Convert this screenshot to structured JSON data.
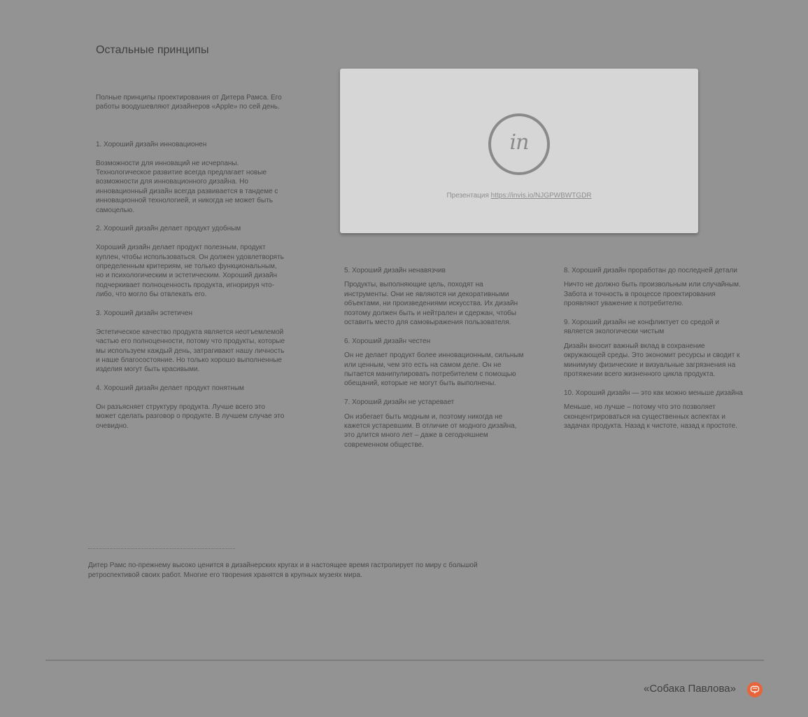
{
  "section_title": "Остальные принципы",
  "intro": "Полные  принципы проектирования от Дитера Рамса. Его работы воодушевляют дизайнеров «Apple» по сей день.",
  "principles": [
    {
      "title": "1. Хороший дизайн инновационен",
      "text": "Возможности для инноваций не исчерпаны. Технологическое развитие всегда предлагает новые возможности для инновационного дизайна. Но инновационный дизайн всегда развивается в тандеме с инновационной технологией, и никогда не может быть самоцелью."
    },
    {
      "title": "2. Хороший дизайн делает продукт удобным",
      "text": "Хороший дизайн делает продукт полезным, продукт куплен, чтобы использоваться. Он должен удовлетворять определенным критериям, не только функциональным, но и психологическим и эстетическим. Хороший дизайн подчеркивает полноценность продукта, игнорируя что-либо, что могло бы отвлекать его."
    },
    {
      "title": "3. Хороший дизайн эстетичен",
      "text": "Эстетическое качество продукта является неотъемлемой частью его полноценности, потому что продукты, которые мы используем каждый день, затрагивают нашу личность и наше благосостояние. Но только хорошо выполненные изделия могут быть красивыми."
    },
    {
      "title": "4. Хороший дизайн делает продукт понятным",
      "text": "Он разъясняет структуру продукта. Лучше всего это может сделать разговор о продукте. В лучшем случае это очевидно."
    },
    {
      "title": "5. Хороший дизайн ненавязчив",
      "text": "Продукты, выполняющие цель, походят на инструменты. Они не являются ни декоративными объектами, ни произведениями искусства. Их дизайн поэтому должен быть и нейтрален и сдержан, чтобы оставить место для самовыражения пользователя."
    },
    {
      "title": "6. Хороший дизайн честен",
      "text": "Он не делает продукт более инновационным, сильным или ценным, чем это есть на самом деле. Он не пытается манипулировать потребителем с помощью обещаний, которые не могут быть выполнены."
    },
    {
      "title": "7. Хороший дизайн не устаревает",
      "text": "Он избегает быть модным и, поэтому никогда не кажется устаревшим. В отличие от модного дизайна, это длится много лет – даже в сегодняшнем современном обществе."
    },
    {
      "title": "8. Хороший дизайн проработан до последней детали",
      "text": "Ничто не должно быть произвольным или случайным. Забота и точность в процессе проектирования проявляют уважение к потребителю."
    },
    {
      "title": "9. Хороший дизайн не конфликтует со средой и является экологически чистым",
      "text": "Дизайн вносит важный вклад в сохранение окружающей среды. Это экономит ресурсы и сводит к минимуму физические и визуальные загрязнения на протяжении всего жизненного цикла продукта."
    },
    {
      "title": "10. Хороший дизайн — это как можно меньше дизайна",
      "text": "Меньше, но лучше – потому что это позволяет сконцентрироваться на существенных аспектах и задачах продукта. Назад к чистоте, назад к простоте."
    }
  ],
  "prototype": {
    "logo_text": "in",
    "caption_prefix": "Презентация ",
    "link_text": "https://invis.io/NJGPWBWTGDR"
  },
  "footnote": "Дитер Рамс по-прежнему высоко ценится в дизайнерских кругах и в настоящее время гастролирует по миру с большой ретроспективой своих работ. Многие его творения хранятся в крупных музеях мира.",
  "footer": {
    "brand_name": "«Собака Павлова»",
    "brand_icon": "pavlov-dog-logo-icon"
  },
  "colors": {
    "background": "#939393",
    "card": "#d6d6d6",
    "brand_accent": "#e8643a"
  }
}
